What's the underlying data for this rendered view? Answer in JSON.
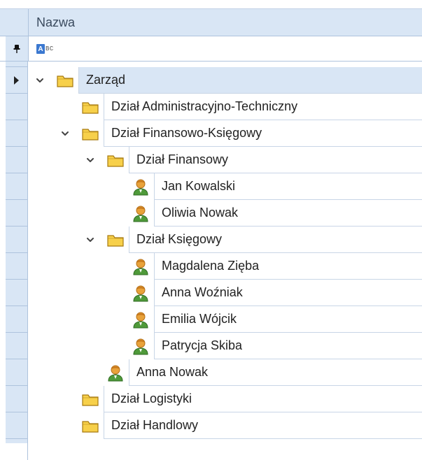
{
  "header": {
    "column_title": "Nazwa"
  },
  "filter": {
    "abc_a": "A",
    "abc_rest": "BC"
  },
  "rows": [
    {
      "label": "Zarząd",
      "level": 0,
      "type": "folder",
      "expanded": true,
      "selected": true,
      "current": true
    },
    {
      "label": "Dział Administracyjno-Techniczny",
      "level": 1,
      "type": "folder",
      "expanded": null,
      "selected": false,
      "current": false
    },
    {
      "label": "Dział Finansowo-Księgowy",
      "level": 1,
      "type": "folder",
      "expanded": true,
      "selected": false,
      "current": false
    },
    {
      "label": "Dział Finansowy",
      "level": 2,
      "type": "folder",
      "expanded": true,
      "selected": false,
      "current": false
    },
    {
      "label": "Jan Kowalski",
      "level": 3,
      "type": "person",
      "expanded": null,
      "selected": false,
      "current": false
    },
    {
      "label": "Oliwia Nowak",
      "level": 3,
      "type": "person",
      "expanded": null,
      "selected": false,
      "current": false
    },
    {
      "label": "Dział Księgowy",
      "level": 2,
      "type": "folder",
      "expanded": true,
      "selected": false,
      "current": false
    },
    {
      "label": "Magdalena Zięba",
      "level": 3,
      "type": "person",
      "expanded": null,
      "selected": false,
      "current": false
    },
    {
      "label": "Anna Woźniak",
      "level": 3,
      "type": "person",
      "expanded": null,
      "selected": false,
      "current": false
    },
    {
      "label": "Emilia Wójcik",
      "level": 3,
      "type": "person",
      "expanded": null,
      "selected": false,
      "current": false
    },
    {
      "label": "Patrycja Skiba",
      "level": 3,
      "type": "person",
      "expanded": null,
      "selected": false,
      "current": false
    },
    {
      "label": "Anna Nowak",
      "level": 2,
      "type": "person",
      "expanded": null,
      "selected": false,
      "current": false
    },
    {
      "label": "Dział Logistyki",
      "level": 1,
      "type": "folder",
      "expanded": null,
      "selected": false,
      "current": false
    },
    {
      "label": "Dział Handlowy",
      "level": 1,
      "type": "folder",
      "expanded": null,
      "selected": false,
      "current": false
    }
  ],
  "colors": {
    "header_bg": "#d9e6f5",
    "grid_line": "#aec3dd",
    "selection_bg": "#d9e6f5",
    "folder_fill": "#f7d04a",
    "folder_stroke": "#a77a10",
    "person_green": "#4f9a3a",
    "person_orange": "#e8a23a"
  }
}
